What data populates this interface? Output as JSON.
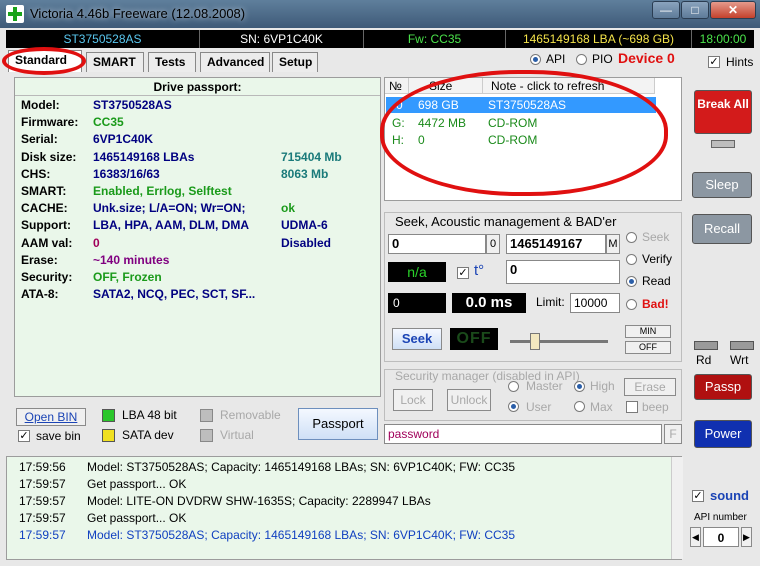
{
  "window": {
    "title": "Victoria 4.46b Freeware (12.08.2008)",
    "minimize": "—",
    "maximize": "□",
    "close": "✕"
  },
  "status": {
    "model": "ST3750528AS",
    "serial": "SN: 6VP1C40K",
    "firmware": "Fw: CC35",
    "lba": "1465149168 LBA (~698 GB)",
    "time": "18:00:00"
  },
  "tabs": [
    "Standard",
    "SMART",
    "Tests",
    "Advanced",
    "Setup"
  ],
  "mode": {
    "api": "API",
    "pio": "PIO",
    "device": "Device 0",
    "hints": "Hints"
  },
  "passport": {
    "header": "Drive passport:",
    "rows": [
      {
        "label": "Model:",
        "value": "ST3750528AS",
        "extra": "",
        "color": "#000080"
      },
      {
        "label": "Firmware:",
        "value": "CC35",
        "extra": "",
        "color": "#1a9a1a"
      },
      {
        "label": "Serial:",
        "value": "6VP1C40K",
        "extra": "",
        "color": "#000080"
      },
      {
        "label": "Disk size:",
        "value": "1465149168 LBAs",
        "extra": "715404 Mb",
        "color": "#000080"
      },
      {
        "label": "CHS:",
        "value": "16383/16/63",
        "extra": "8063 Mb",
        "color": "#000080"
      },
      {
        "label": "SMART:",
        "value": "Enabled, Errlog, Selftest",
        "extra": "",
        "color": "#1a9a1a"
      },
      {
        "label": "CACHE:",
        "value": "Unk.size; L/A=ON; Wr=ON;",
        "extra": "ok",
        "color": "#000080"
      },
      {
        "label": "Support:",
        "value": "LBA, HPA, AAM, DLM, DMA",
        "extra": "UDMA-6",
        "color": "#000080"
      },
      {
        "label": "AAM val:",
        "value": "0",
        "extra": "Disabled",
        "color": "#a0005a"
      },
      {
        "label": "Erase:",
        "value": "~140 minutes",
        "extra": "",
        "color": "#800080"
      },
      {
        "label": "Security:",
        "value": "OFF, Frozen",
        "extra": "",
        "color": "#1a9a1a"
      },
      {
        "label": "ATA-8:",
        "value": "SATA2, NCQ, PEC, SCT, SF...",
        "extra": "",
        "color": "#000080"
      }
    ]
  },
  "passport_footer": {
    "open_bin": "Open BIN",
    "save_bin": "save bin",
    "lba48": "LBA 48 bit",
    "removable": "Removable",
    "sata_dev": "SATA dev",
    "virtual": "Virtual",
    "passport_button": "Passport"
  },
  "drives": {
    "columns": [
      "№",
      "Size",
      "Note - click to refresh"
    ],
    "rows": [
      {
        "num": "0",
        "size": "698 GB",
        "note": "ST3750528AS"
      },
      {
        "num": "G:",
        "size": "4472 MB",
        "note": "CD-ROM"
      },
      {
        "num": "H:",
        "size": "0",
        "note": "CD-ROM"
      }
    ]
  },
  "seek": {
    "title": "Seek, Acoustic management & BAD'er",
    "start": "0",
    "start_btn": "0",
    "end": "1465149167",
    "end_btn": "M",
    "na": "n/a",
    "t_label": "t°",
    "t_value": "0",
    "counter": "0",
    "ms": "0.0 ms",
    "limit_label": "Limit:",
    "limit_value": "10000",
    "seek_button": "Seek",
    "off_display": "OFF",
    "min_button": "MIN",
    "off_button": "OFF",
    "options": [
      "Seek",
      "Verify",
      "Read",
      "Bad!"
    ]
  },
  "security": {
    "title": "Security manager (disabled in API)",
    "lock": "Lock",
    "unlock": "Unlock",
    "master": "Master",
    "high": "High",
    "user": "User",
    "max": "Max",
    "erase": "Erase",
    "beep": "beep",
    "password": "password",
    "f_btn": "F"
  },
  "right": {
    "break_all": "Break All",
    "sleep": "Sleep",
    "recall": "Recall",
    "rd": "Rd",
    "wrt": "Wrt",
    "passp": "Passp",
    "power": "Power",
    "sound": "sound",
    "api_number_label": "API number",
    "api_number": "0"
  },
  "log": [
    {
      "time": "17:59:56",
      "msg": "Model: ST3750528AS; Capacity: 1465149168 LBAs; SN: 6VP1C40K; FW: CC35",
      "color": "#000000"
    },
    {
      "time": "17:59:57",
      "msg": "Get passport... OK",
      "color": "#000000"
    },
    {
      "time": "17:59:57",
      "msg": "Model: LITE-ON DVDRW SHW-1635S; Capacity: 2289947 LBAs",
      "color": "#000000"
    },
    {
      "time": "17:59:57",
      "msg": "Get passport... OK",
      "color": "#000000"
    },
    {
      "time": "17:59:57",
      "msg": "Model: ST3750528AS; Capacity: 1465149168 LBAs; SN: 6VP1C40K; FW: CC35",
      "color": "#1040c0"
    }
  ]
}
